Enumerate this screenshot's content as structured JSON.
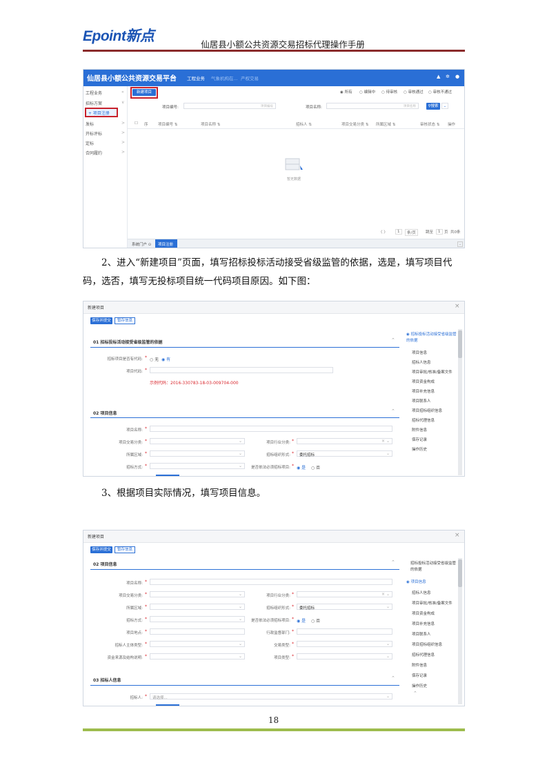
{
  "header": {
    "logo": "Epoint新点",
    "title": "仙居县小额公共资源交易招标代理操作手册"
  },
  "shot1": {
    "title": "仙居县小额公共资源交易平台",
    "nav": [
      "工程业务",
      "气象机构在...",
      "产权交易"
    ],
    "sidebar": [
      {
        "label": "工程业务",
        "arrow": "«"
      },
      {
        "label": "招标方案",
        "arrow": "∨"
      },
      {
        "label": "+ 项目注册",
        "arrow": ""
      },
      {
        "label": "发标",
        "arrow": ">"
      },
      {
        "label": "开标评标",
        "arrow": ">"
      },
      {
        "label": "定标",
        "arrow": ">"
      },
      {
        "label": "合同履约",
        "arrow": ">"
      }
    ],
    "new_btn": "新建项目",
    "filters": [
      "所有",
      "编辑中",
      "待审核",
      "审核通过",
      "审核不通过"
    ],
    "code_label": "项目编号:",
    "code_ph": "项目编号",
    "name_label": "项目名称:",
    "name_ph": "项目名称",
    "search_btn": "搜索",
    "columns": [
      "序",
      "项目编号 ⇅",
      "项目名称 ⇅",
      "招标人 ⇅",
      "项目交易分类 ⇅",
      "所属区域 ⇅",
      "审核状态 ⇅",
      "操作"
    ],
    "empty_text": "暂无数据",
    "pager": {
      "prefix": "〈  〉",
      "page": "1",
      "size": "条/页",
      "goto": "跳至",
      "page_input": "1",
      "page_unit": "页",
      "total": "共0条"
    },
    "bottom_tabs": [
      "系统门户 ⊙",
      "项目注册"
    ]
  },
  "para2": "2、进入“新建项目”页面，填写招标投标活动接受省级监管的依据，选是，填写项目代码，选否，填写无投标项目统一代码项目原因。如下图：",
  "para3": "3、根据项目实际情况，填写项目信息。",
  "dlg": {
    "title": "新建项目",
    "close": "×",
    "save_btn": "保存并提交",
    "draft_btn": "暂存信息"
  },
  "shot2": {
    "sec1": "01 招标投标活动接受省级监管的依据",
    "q1_label": "招标项目是否有代码:",
    "q1_opts": [
      "○ 无",
      "◉ 有"
    ],
    "q2_label": "项目代码:",
    "example": "示例代码：2016-330783-18-03-009704-000",
    "sec2": "02 项目信息",
    "f_name": "项目名称:",
    "f_class": "项目交易分类:",
    "f_industry": "项目行业分类:",
    "f_region": "所属区域:",
    "f_method": "招标组织形式:",
    "f_method_val": "委托招标",
    "f_law": "招标方式:",
    "f_isgov": "是否依法必须招标项目:",
    "f_isgov_opts": [
      "◉ 是",
      "○ 否"
    ],
    "nav": [
      "招标投标活动接受省级监管的依据",
      "项目信息",
      "招标人信息",
      "项目审批/核准/备案文件",
      "项目资金构成",
      "项目补充信息",
      "项目联系人",
      "项目招标组织信息",
      "招标代理信息",
      "附件信息",
      "保存记录",
      "操作历史"
    ]
  },
  "shot3": {
    "sec2": "02 项目信息",
    "f_name": "项目名称:",
    "f_class": "项目交易分类:",
    "f_industry": "项目行业分类:",
    "f_region": "所属区域:",
    "f_method": "招标组织形式:",
    "f_method_val": "委托招标",
    "f_law": "招标方式:",
    "f_isgov": "是否依法必须招标项目:",
    "f_isgov_opts": [
      "◉ 是",
      "○ 否"
    ],
    "f_addr": "项目地点:",
    "f_dept": "行政监督部门:",
    "f_body": "招标人主体类型:",
    "f_reg": "交易类型:",
    "f_fund": "资金来源及结构说明:",
    "f_type": "项目类型:",
    "sec3": "03 招标人信息",
    "f_tender": "招标人:",
    "f_tender_ph": "请选择...",
    "nav": [
      "招标投标活动接受省级监管的依据",
      "项目信息",
      "招标人信息",
      "项目审批/核准/备案文件",
      "项目资金构成",
      "项目补充信息",
      "项目联系人",
      "项目招标组织信息",
      "招标代理信息",
      "附件信息",
      "保存记录",
      "操作历史"
    ]
  },
  "page_number": "18"
}
